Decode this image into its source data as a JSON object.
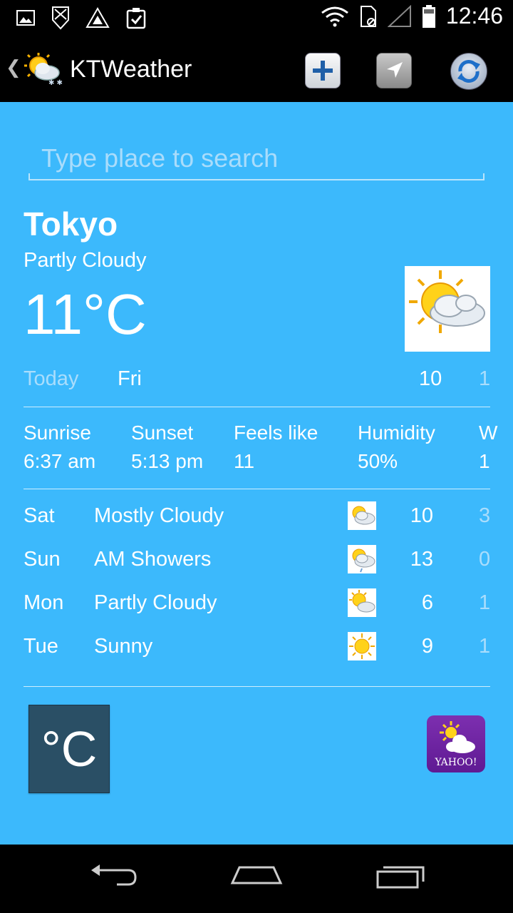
{
  "status_bar": {
    "time": "12:46",
    "icons_left": [
      "image-icon",
      "download-icon",
      "triangle-logo-icon",
      "clipboard-check-icon"
    ],
    "icons_right": [
      "wifi-icon",
      "sim-icon",
      "signal-icon",
      "battery-icon"
    ]
  },
  "action_bar": {
    "title": "KTWeather",
    "buttons": [
      "add-icon",
      "location-arrow-icon",
      "refresh-icon"
    ]
  },
  "search": {
    "placeholder": "Type place to search",
    "value": ""
  },
  "current": {
    "city": "Tokyo",
    "condition": "Partly Cloudy",
    "temperature": "11°C",
    "icon": "partly-cloudy-icon"
  },
  "today": {
    "label": "Today",
    "day": "Fri",
    "high": "10",
    "low": "1"
  },
  "details": [
    {
      "label": "Sunrise",
      "value": "6:37 am"
    },
    {
      "label": "Sunset",
      "value": "5:13 pm"
    },
    {
      "label": "Feels like",
      "value": "11"
    },
    {
      "label": "Humidity",
      "value": "50%"
    },
    {
      "label": "W",
      "value": "1"
    }
  ],
  "forecast": [
    {
      "day": "Sat",
      "condition": "Mostly Cloudy",
      "icon": "mostly-cloudy-icon",
      "high": "10",
      "low": "3"
    },
    {
      "day": "Sun",
      "condition": "AM Showers",
      "icon": "showers-icon",
      "high": "13",
      "low": "0"
    },
    {
      "day": "Mon",
      "condition": "Partly Cloudy",
      "icon": "partly-cloudy-icon",
      "high": "6",
      "low": "1"
    },
    {
      "day": "Tue",
      "condition": "Sunny",
      "icon": "sunny-icon",
      "high": "9",
      "low": "1"
    }
  ],
  "unit_toggle": {
    "label": "°C"
  },
  "yahoo": {
    "label": "YAHOO!"
  },
  "colors": {
    "background": "#3cb9fc",
    "muted_text": "#a9ddfc",
    "unit_button": "#2a4f65",
    "yahoo_purple": "#7d2fb0"
  }
}
